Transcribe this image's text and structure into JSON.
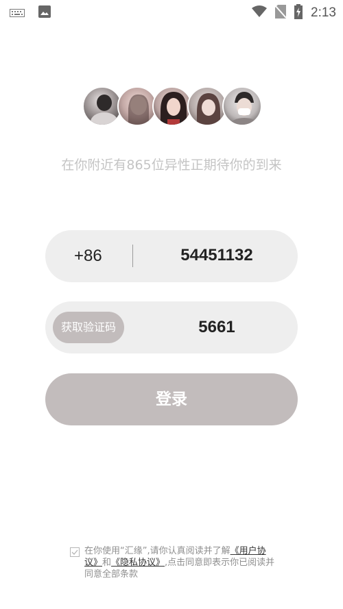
{
  "status_bar": {
    "time": "2:13",
    "icons": [
      "keyboard-icon",
      "image-icon",
      "wifi-icon",
      "no-sim-icon",
      "battery-charging-icon"
    ]
  },
  "avatars": [
    "avatar-1",
    "avatar-2",
    "avatar-3",
    "avatar-4",
    "avatar-5"
  ],
  "tagline": "在你附近有865位异性正期待你的到来",
  "phone": {
    "country_code": "+86",
    "value": "54451132"
  },
  "code": {
    "button_label": "获取验证码",
    "value": "5661"
  },
  "login_label": "登录",
  "agreement": {
    "text_before": "在你使用“汇缘”,请你认真阅读并了解",
    "user_link": "《用户协议》",
    "and": "和",
    "privacy_link": "《隐私协议》",
    "text_after": ",点击同意即表示你已阅读并同意全部条款"
  },
  "colors": {
    "accent": "#c2bcbc",
    "field_bg": "#eeeeee",
    "tagline": "#c4c4c4"
  }
}
